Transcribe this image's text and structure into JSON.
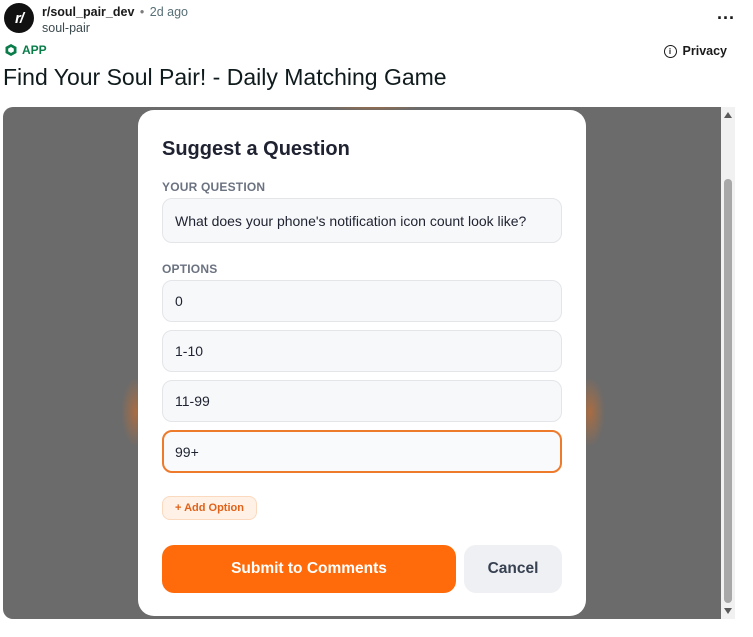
{
  "post": {
    "avatar_text": "r/",
    "subreddit": "r/soul_pair_dev",
    "separator": "•",
    "time_ago": "2d ago",
    "username": "soul-pair",
    "more_label": "...",
    "app_badge": "APP",
    "privacy_label": "Privacy",
    "info_glyph": "i",
    "title": "Find Your Soul Pair! - Daily Matching Game"
  },
  "modal": {
    "title": "Suggest a Question",
    "question_label": "YOUR QUESTION",
    "question_value": "What does your phone's notification icon count look like?",
    "options_label": "OPTIONS",
    "options": [
      "0",
      "1-10",
      "11-99",
      "99+"
    ],
    "add_option_label": "+ Add Option",
    "submit_label": "Submit to Comments",
    "cancel_label": "Cancel"
  },
  "colors": {
    "accent": "#ff6b0a",
    "focus_border": "#ee7a2c",
    "app_badge": "#0a7c4a",
    "overlay": "#6b6b6b"
  },
  "icons": {
    "avatar": "reddit-avatar",
    "more": "more-horizontal-icon",
    "app": "app-cube-icon",
    "privacy": "info-icon"
  }
}
